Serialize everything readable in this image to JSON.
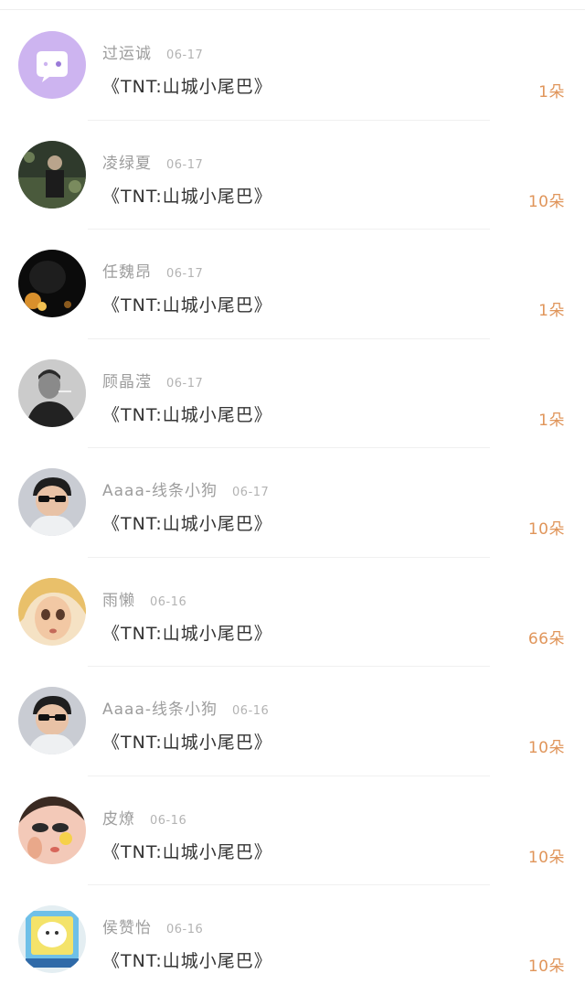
{
  "rows": [
    {
      "name": "过运诚",
      "date": "06-17",
      "title": "《TNT:山城小尾巴》",
      "count": "1朵",
      "avatar": "chat-bubble-avatar"
    },
    {
      "name": "凌绿夏",
      "date": "06-17",
      "title": "《TNT:山城小尾巴》",
      "count": "10朵",
      "avatar": "dark-photo-avatar"
    },
    {
      "name": "任魏昂",
      "date": "06-17",
      "title": "《TNT:山城小尾巴》",
      "count": "1朵",
      "avatar": "night-photo-avatar"
    },
    {
      "name": "顾晶滢",
      "date": "06-17",
      "title": "《TNT:山城小尾巴》",
      "count": "1朵",
      "avatar": "grayscale-portrait-avatar"
    },
    {
      "name": "Aaaa-线条小狗",
      "date": "06-17",
      "title": "《TNT:山城小尾巴》",
      "count": "10朵",
      "avatar": "sunglasses-avatar"
    },
    {
      "name": "雨懒",
      "date": "06-16",
      "title": "《TNT:山城小尾巴》",
      "count": "66朵",
      "avatar": "cartoon-girl-avatar"
    },
    {
      "name": "Aaaa-线条小狗",
      "date": "06-16",
      "title": "《TNT:山城小尾巴》",
      "count": "10朵",
      "avatar": "sunglasses-avatar"
    },
    {
      "name": "皮燎",
      "date": "06-16",
      "title": "《TNT:山城小尾巴》",
      "count": "10朵",
      "avatar": "anime-avatar"
    },
    {
      "name": "侯赞怡",
      "date": "06-16",
      "title": "《TNT:山城小尾巴》",
      "count": "10朵",
      "avatar": "cartoon-sticker-avatar"
    }
  ],
  "colors": {
    "count": "#e0955a",
    "name": "#9d9d9d",
    "title": "#333333",
    "avatar_purple": "#cdb4f0"
  }
}
